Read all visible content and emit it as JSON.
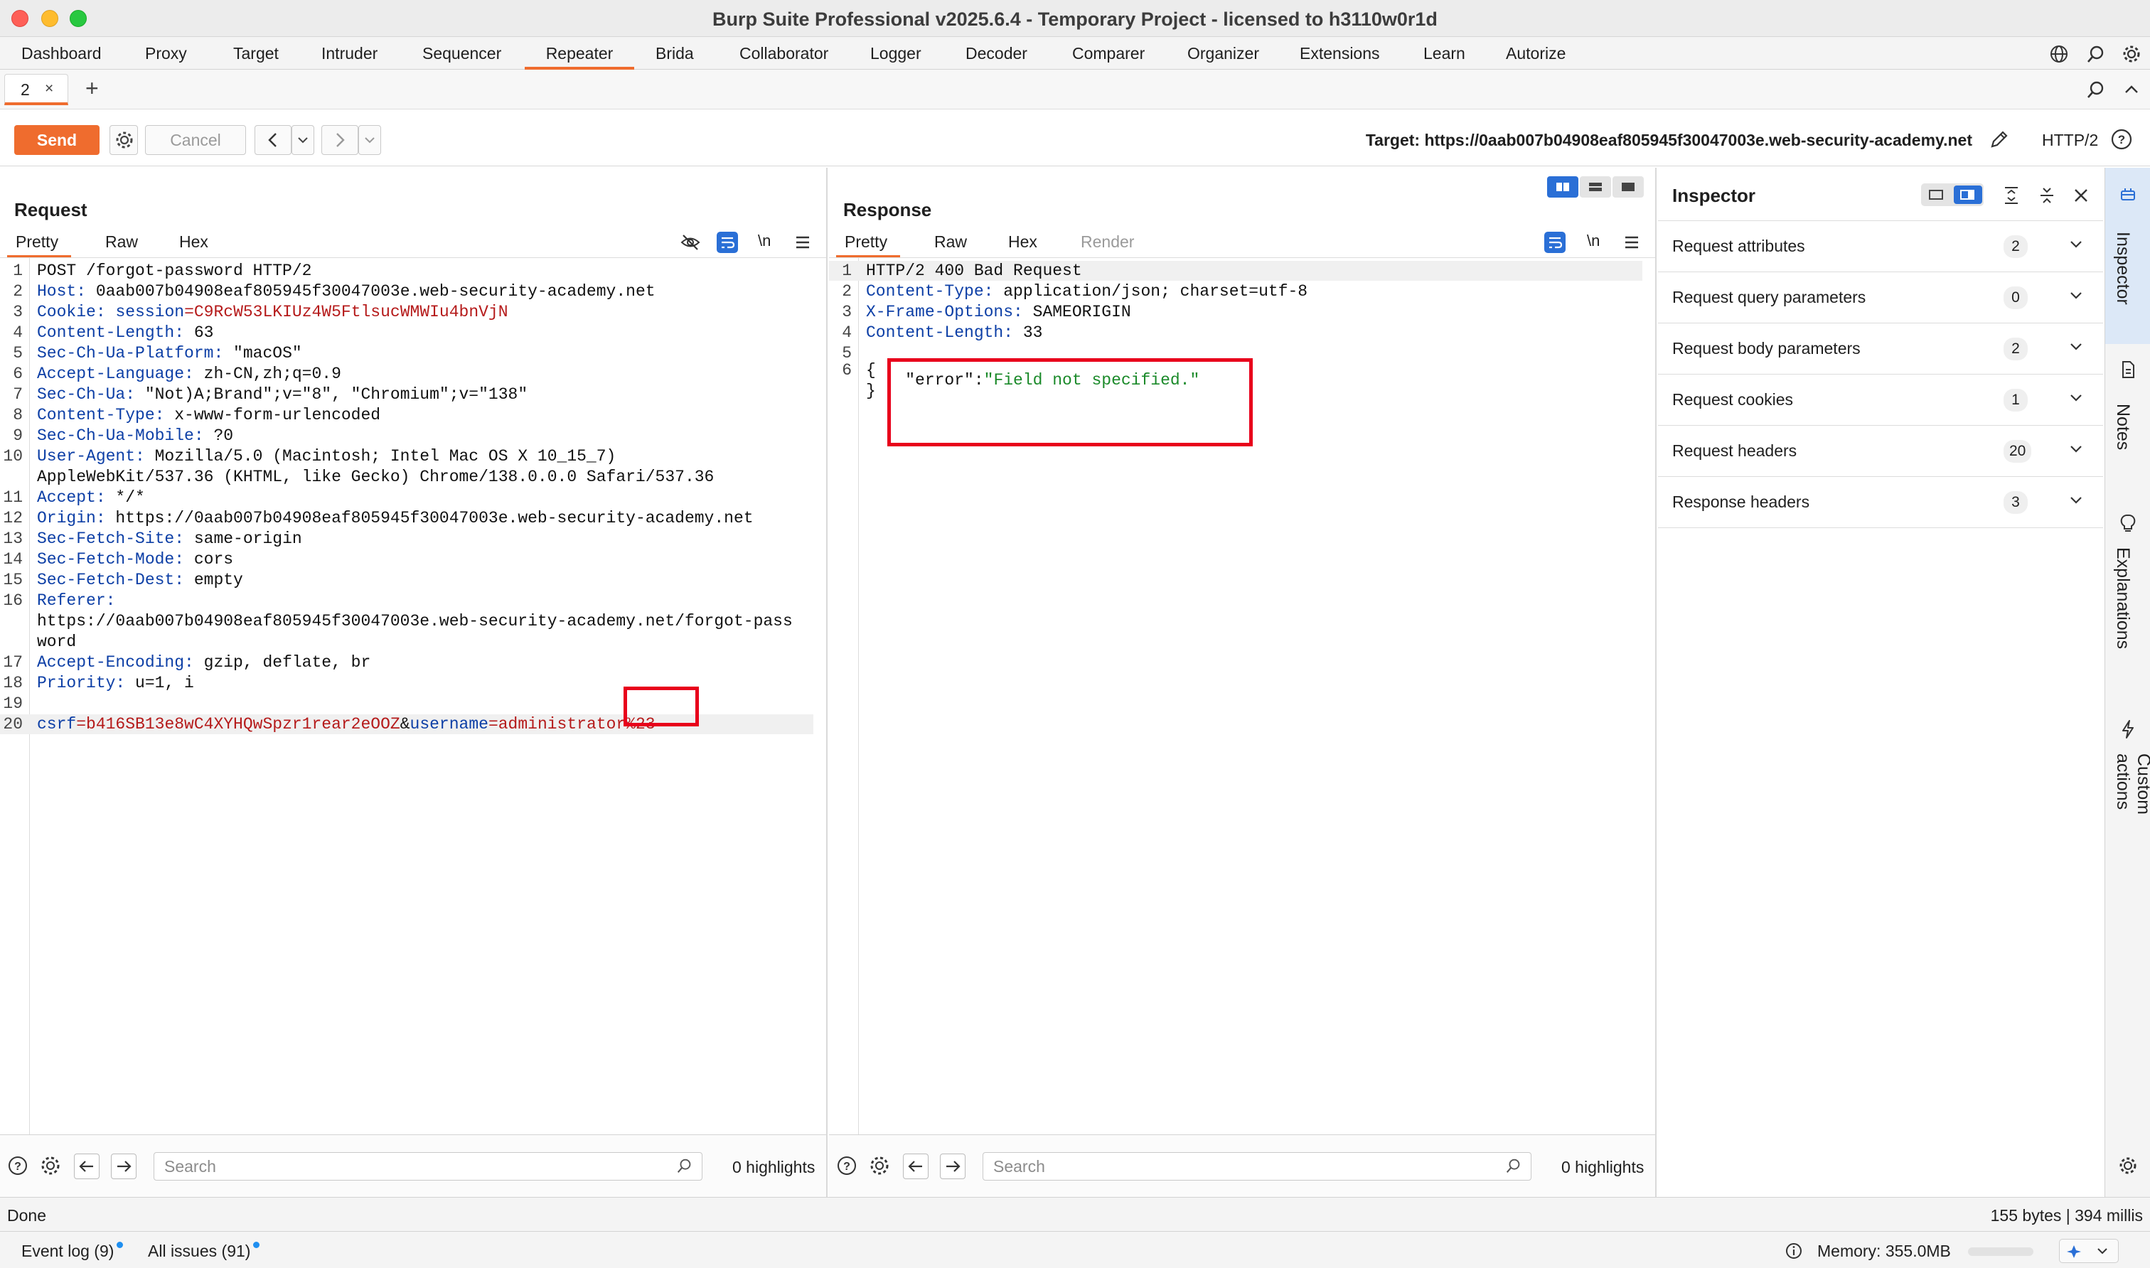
{
  "window": {
    "title": "Burp Suite Professional v2025.6.4 - Temporary Project - licensed to h3110w0r1d"
  },
  "menu_tabs": [
    {
      "label": "Dashboard"
    },
    {
      "label": "Proxy"
    },
    {
      "label": "Target"
    },
    {
      "label": "Intruder"
    },
    {
      "label": "Sequencer"
    },
    {
      "label": "Repeater",
      "active": true
    },
    {
      "label": "Brida"
    },
    {
      "label": "Collaborator"
    },
    {
      "label": "Logger"
    },
    {
      "label": "Decoder"
    },
    {
      "label": "Comparer"
    },
    {
      "label": "Organizer"
    },
    {
      "label": "Extensions"
    },
    {
      "label": "Learn"
    },
    {
      "label": "Autorize"
    }
  ],
  "repeater_tabs": [
    {
      "label": "2",
      "close": "×"
    }
  ],
  "add_tab": "+",
  "toolbar": {
    "send": "Send",
    "cancel": "Cancel",
    "target": "Target: https://0aab007b04908eaf805945f30047003e.web-security-academy.net",
    "http_version": "HTTP/2"
  },
  "request": {
    "title": "Request",
    "tabs": [
      "Pretty",
      "Raw",
      "Hex"
    ],
    "active_tab": "Pretty",
    "wrap_toggle": "\\n",
    "lines": [
      {
        "n": "1",
        "parts": [
          {
            "t": "POST /forgot-password HTTP/2",
            "c": ""
          }
        ]
      },
      {
        "n": "2",
        "parts": [
          {
            "t": "Host:",
            "c": "hk"
          },
          {
            "t": " 0aab007b04908eaf805945f30047003e.web-security-academy.net",
            "c": ""
          }
        ]
      },
      {
        "n": "3",
        "parts": [
          {
            "t": "Cookie:",
            "c": "hk"
          },
          {
            "t": " ",
            "c": ""
          },
          {
            "t": "session",
            "c": "hk"
          },
          {
            "t": "=C9RcW53LKIUz4W5FtlsucWMWIu4bnVjN",
            "c": "sv"
          }
        ]
      },
      {
        "n": "4",
        "parts": [
          {
            "t": "Content-Length:",
            "c": "hk"
          },
          {
            "t": " 63",
            "c": ""
          }
        ]
      },
      {
        "n": "5",
        "parts": [
          {
            "t": "Sec-Ch-Ua-Platform:",
            "c": "hk"
          },
          {
            "t": " \"macOS\"",
            "c": ""
          }
        ]
      },
      {
        "n": "6",
        "parts": [
          {
            "t": "Accept-Language:",
            "c": "hk"
          },
          {
            "t": " zh-CN,zh;q=0.9",
            "c": ""
          }
        ]
      },
      {
        "n": "7",
        "parts": [
          {
            "t": "Sec-Ch-Ua:",
            "c": "hk"
          },
          {
            "t": " \"Not)A;Brand\";v=\"8\", \"Chromium\";v=\"138\"",
            "c": ""
          }
        ]
      },
      {
        "n": "8",
        "parts": [
          {
            "t": "Content-Type:",
            "c": "hk"
          },
          {
            "t": " x-www-form-urlencoded",
            "c": ""
          }
        ]
      },
      {
        "n": "9",
        "parts": [
          {
            "t": "Sec-Ch-Ua-Mobile:",
            "c": "hk"
          },
          {
            "t": " ?0",
            "c": ""
          }
        ]
      },
      {
        "n": "10",
        "parts": [
          {
            "t": "User-Agent:",
            "c": "hk"
          },
          {
            "t": " Mozilla/5.0 (Macintosh; Intel Mac OS X 10_15_7)",
            "c": ""
          }
        ]
      },
      {
        "n": "",
        "parts": [
          {
            "t": "AppleWebKit/537.36 (KHTML, like Gecko) Chrome/138.0.0.0 Safari/537.36",
            "c": ""
          }
        ]
      },
      {
        "n": "11",
        "parts": [
          {
            "t": "Accept:",
            "c": "hk"
          },
          {
            "t": " */*",
            "c": ""
          }
        ]
      },
      {
        "n": "12",
        "parts": [
          {
            "t": "Origin:",
            "c": "hk"
          },
          {
            "t": " https://0aab007b04908eaf805945f30047003e.web-security-academy.net",
            "c": ""
          }
        ]
      },
      {
        "n": "13",
        "parts": [
          {
            "t": "Sec-Fetch-Site:",
            "c": "hk"
          },
          {
            "t": " same-origin",
            "c": ""
          }
        ]
      },
      {
        "n": "14",
        "parts": [
          {
            "t": "Sec-Fetch-Mode:",
            "c": "hk"
          },
          {
            "t": " cors",
            "c": ""
          }
        ]
      },
      {
        "n": "15",
        "parts": [
          {
            "t": "Sec-Fetch-Dest:",
            "c": "hk"
          },
          {
            "t": " empty",
            "c": ""
          }
        ]
      },
      {
        "n": "16",
        "parts": [
          {
            "t": "Referer:",
            "c": "hk"
          }
        ]
      },
      {
        "n": "",
        "parts": [
          {
            "t": "https://0aab007b04908eaf805945f30047003e.web-security-academy.net/forgot-pass",
            "c": ""
          }
        ]
      },
      {
        "n": "",
        "parts": [
          {
            "t": "word",
            "c": ""
          }
        ]
      },
      {
        "n": "17",
        "parts": [
          {
            "t": "Accept-Encoding:",
            "c": "hk"
          },
          {
            "t": " gzip, deflate, br",
            "c": ""
          }
        ]
      },
      {
        "n": "18",
        "parts": [
          {
            "t": "Priority:",
            "c": "hk"
          },
          {
            "t": " u=1, i",
            "c": ""
          }
        ]
      },
      {
        "n": "19",
        "parts": []
      },
      {
        "n": "20",
        "hl": true,
        "parts": [
          {
            "t": "csrf",
            "c": "hk"
          },
          {
            "t": "=b416SB13e8wC4XYHQwSpzr1rear2eOOZ",
            "c": "sv"
          },
          {
            "t": "&",
            "c": ""
          },
          {
            "t": "username",
            "c": "hk"
          },
          {
            "t": "=administrator%23",
            "c": "sv"
          }
        ]
      }
    ],
    "search_placeholder": "Search",
    "highlights": "0 highlights"
  },
  "response": {
    "title": "Response",
    "tabs": [
      "Pretty",
      "Raw",
      "Hex",
      "Render"
    ],
    "active_tab": "Pretty",
    "wrap_toggle": "\\n",
    "lines": [
      {
        "n": "1",
        "hl": true,
        "parts": [
          {
            "t": "HTTP/2 400 Bad Request",
            "c": ""
          }
        ]
      },
      {
        "n": "2",
        "parts": [
          {
            "t": "Content-Type:",
            "c": "hk"
          },
          {
            "t": " application/json; charset=utf-8",
            "c": ""
          }
        ]
      },
      {
        "n": "3",
        "parts": [
          {
            "t": "X-Frame-Options:",
            "c": "hk"
          },
          {
            "t": " SAMEORIGIN",
            "c": ""
          }
        ]
      },
      {
        "n": "4",
        "parts": [
          {
            "t": "Content-Length:",
            "c": "hk"
          },
          {
            "t": " 33",
            "c": ""
          }
        ]
      },
      {
        "n": "5",
        "parts": []
      },
      {
        "n": "6",
        "parts": [
          {
            "t": "{",
            "c": ""
          }
        ]
      },
      {
        "n": "",
        "parts": [
          {
            "t": "    \"error\":",
            "c": "json-key"
          },
          {
            "t": "\"Field not specified.\"",
            "c": "json-str"
          }
        ]
      },
      {
        "n": "",
        "parts": [
          {
            "t": "}",
            "c": ""
          }
        ]
      }
    ],
    "search_placeholder": "Search",
    "highlights": "0 highlights"
  },
  "inspector": {
    "title": "Inspector",
    "rows": [
      {
        "label": "Request attributes",
        "count": "2"
      },
      {
        "label": "Request query parameters",
        "count": "0"
      },
      {
        "label": "Request body parameters",
        "count": "2"
      },
      {
        "label": "Request cookies",
        "count": "1"
      },
      {
        "label": "Request headers",
        "count": "20"
      },
      {
        "label": "Response headers",
        "count": "3"
      }
    ]
  },
  "side_rail": [
    {
      "label": "Inspector",
      "active": true
    },
    {
      "label": "Notes"
    },
    {
      "label": "Explanations"
    },
    {
      "label": "Custom actions"
    }
  ],
  "status": {
    "left": "Done",
    "right": "155 bytes | 394 millis"
  },
  "bottom": {
    "event_log": "Event log (9)",
    "all_issues": "All issues (91)",
    "memory": "Memory: 355.0MB"
  },
  "colors": {
    "accent": "#ef6c2e",
    "header_key": "#0d3fa6",
    "value_red": "#b51a1a",
    "json_string": "#1b8a2a",
    "annotation_box": "#e8001b"
  }
}
